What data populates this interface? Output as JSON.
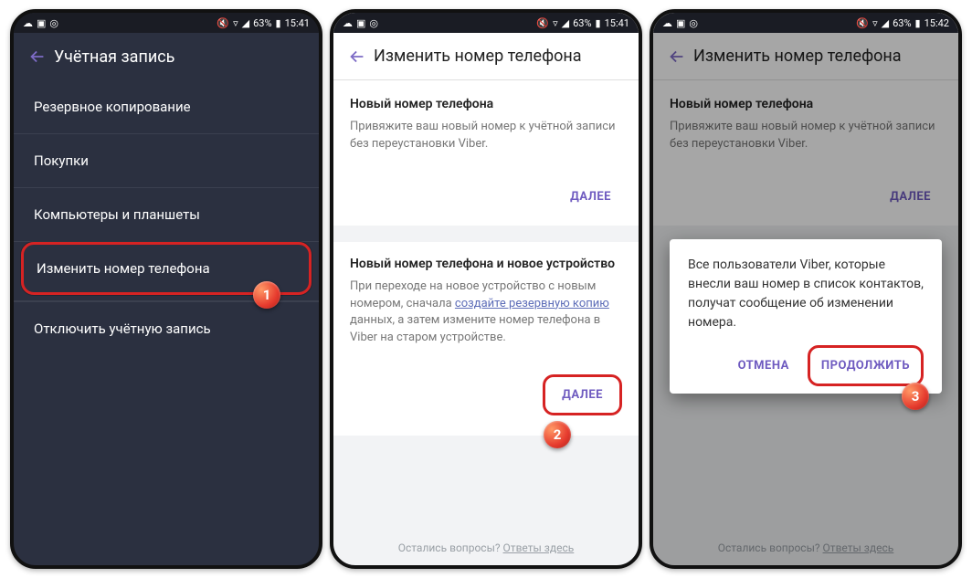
{
  "status": {
    "battery": "63%",
    "time1": "15:41",
    "time2": "15:41",
    "time3": "15:42",
    "signal": "📶",
    "wifi": "📡"
  },
  "screen1": {
    "title": "Учётная запись",
    "items": [
      "Резервное копирование",
      "Покупки",
      "Компьютеры и планшеты"
    ],
    "highlighted": "Изменить номер телефона",
    "after": "Отключить учётную запись"
  },
  "screen2": {
    "title": "Изменить номер телефона",
    "card1": {
      "heading": "Новый номер телефона",
      "desc": "Привяжите ваш новый номер к учётной записи без переустановки Viber."
    },
    "next": "ДАЛЕЕ",
    "card2": {
      "heading": "Новый номер телефона и новое устройство",
      "desc_before": "При переходе на новое устройство с новым номером, сначала ",
      "desc_link": "создайте резервную копию",
      "desc_after": " данных, а затем измените номер телефона в Viber на старом устройстве."
    },
    "footer_q": "Остались вопросы? ",
    "footer_link": "Ответы здесь"
  },
  "screen3": {
    "title": "Изменить номер телефона",
    "dialog": {
      "text": "Все пользователи Viber, которые внесли ваш номер в список контактов, получат сообщение об изменении номера.",
      "cancel": "ОТМЕНА",
      "continue": "ПРОДОЛЖИТЬ"
    }
  },
  "step_labels": {
    "s1": "1",
    "s2": "2",
    "s3": "3"
  }
}
